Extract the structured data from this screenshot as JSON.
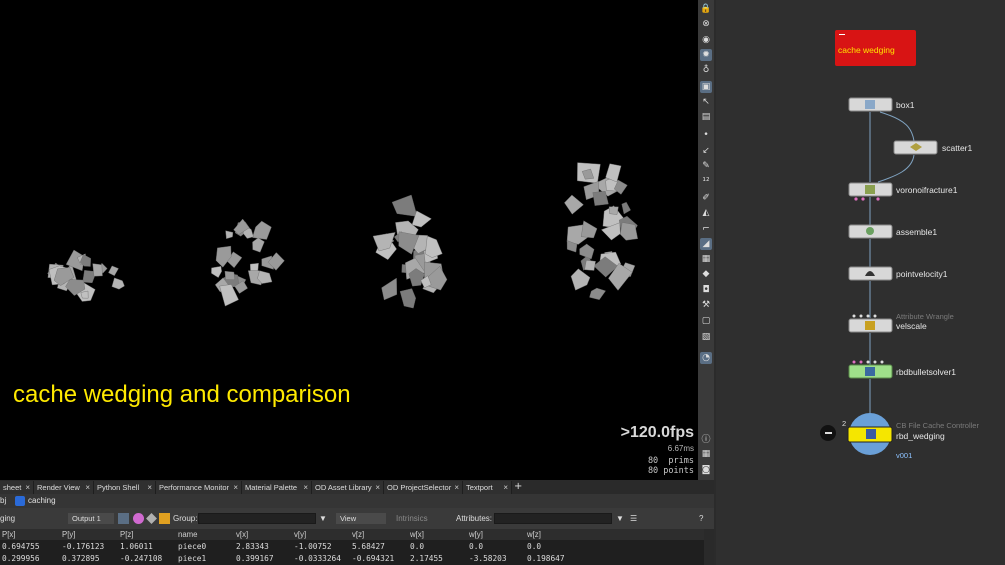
{
  "viewport": {
    "caption": "cache wedging and comparison",
    "fps": ">120.0fps",
    "frame_ms": "6.67ms",
    "prims": "80  prims",
    "points": "80 points"
  },
  "network": {
    "sticky_note": "cache wedging",
    "nodes": [
      {
        "id": "box1",
        "label": "box1"
      },
      {
        "id": "scatter1",
        "label": "scatter1"
      },
      {
        "id": "voronoifracture1",
        "label": "voronoifracture1"
      },
      {
        "id": "assemble1",
        "label": "assemble1"
      },
      {
        "id": "pointvelocity1",
        "label": "pointvelocity1"
      },
      {
        "id": "velscale",
        "label": "velscale",
        "type": "Attribute Wrangle"
      },
      {
        "id": "rbdbulletsolver1",
        "label": "rbdbulletsolver1"
      },
      {
        "id": "rbd_wedging",
        "label": "rbd_wedging",
        "type": "CB File Cache Controller",
        "version": "v001",
        "badge": "2"
      }
    ]
  },
  "bottom_panel": {
    "tabs": [
      "sheet",
      "Render View",
      "Python Shell",
      "Performance Monitor",
      "Material Palette",
      "OD Asset Library",
      "OD ProjectSelector",
      "Textport"
    ],
    "tab_add": "+",
    "path": "caching",
    "path_prefix": "bj",
    "toolbar": {
      "node_name": "ging",
      "output_select": "Output 1",
      "group_label": "Group:",
      "view_select": "View",
      "intrinsics_label": "Intrinsics",
      "attributes_label": "Attributes:"
    },
    "table": {
      "columns": [
        "P[x]",
        "P[y]",
        "P[z]",
        "name",
        "v[x]",
        "v[y]",
        "v[z]",
        "w[x]",
        "w[y]",
        "w[z]"
      ],
      "rows": [
        [
          "0.694755",
          "-0.176123",
          "1.06011",
          "piece0",
          "2.83343",
          "-1.00752",
          "5.68427",
          "0.0",
          "0.0",
          "0.0"
        ],
        [
          "0.299956",
          "0.372895",
          "-0.247108",
          "piece1",
          "0.399167",
          "-0.0333264",
          "-0.694321",
          "2.17455",
          "-3.58203",
          "0.198647"
        ]
      ]
    }
  },
  "colors": {
    "caption": "#ffea00",
    "sticky_bg": "#d81414",
    "sticky_text": "#ffe400",
    "cache_node": "#f5e600",
    "solver_node": "#9fe08a"
  }
}
